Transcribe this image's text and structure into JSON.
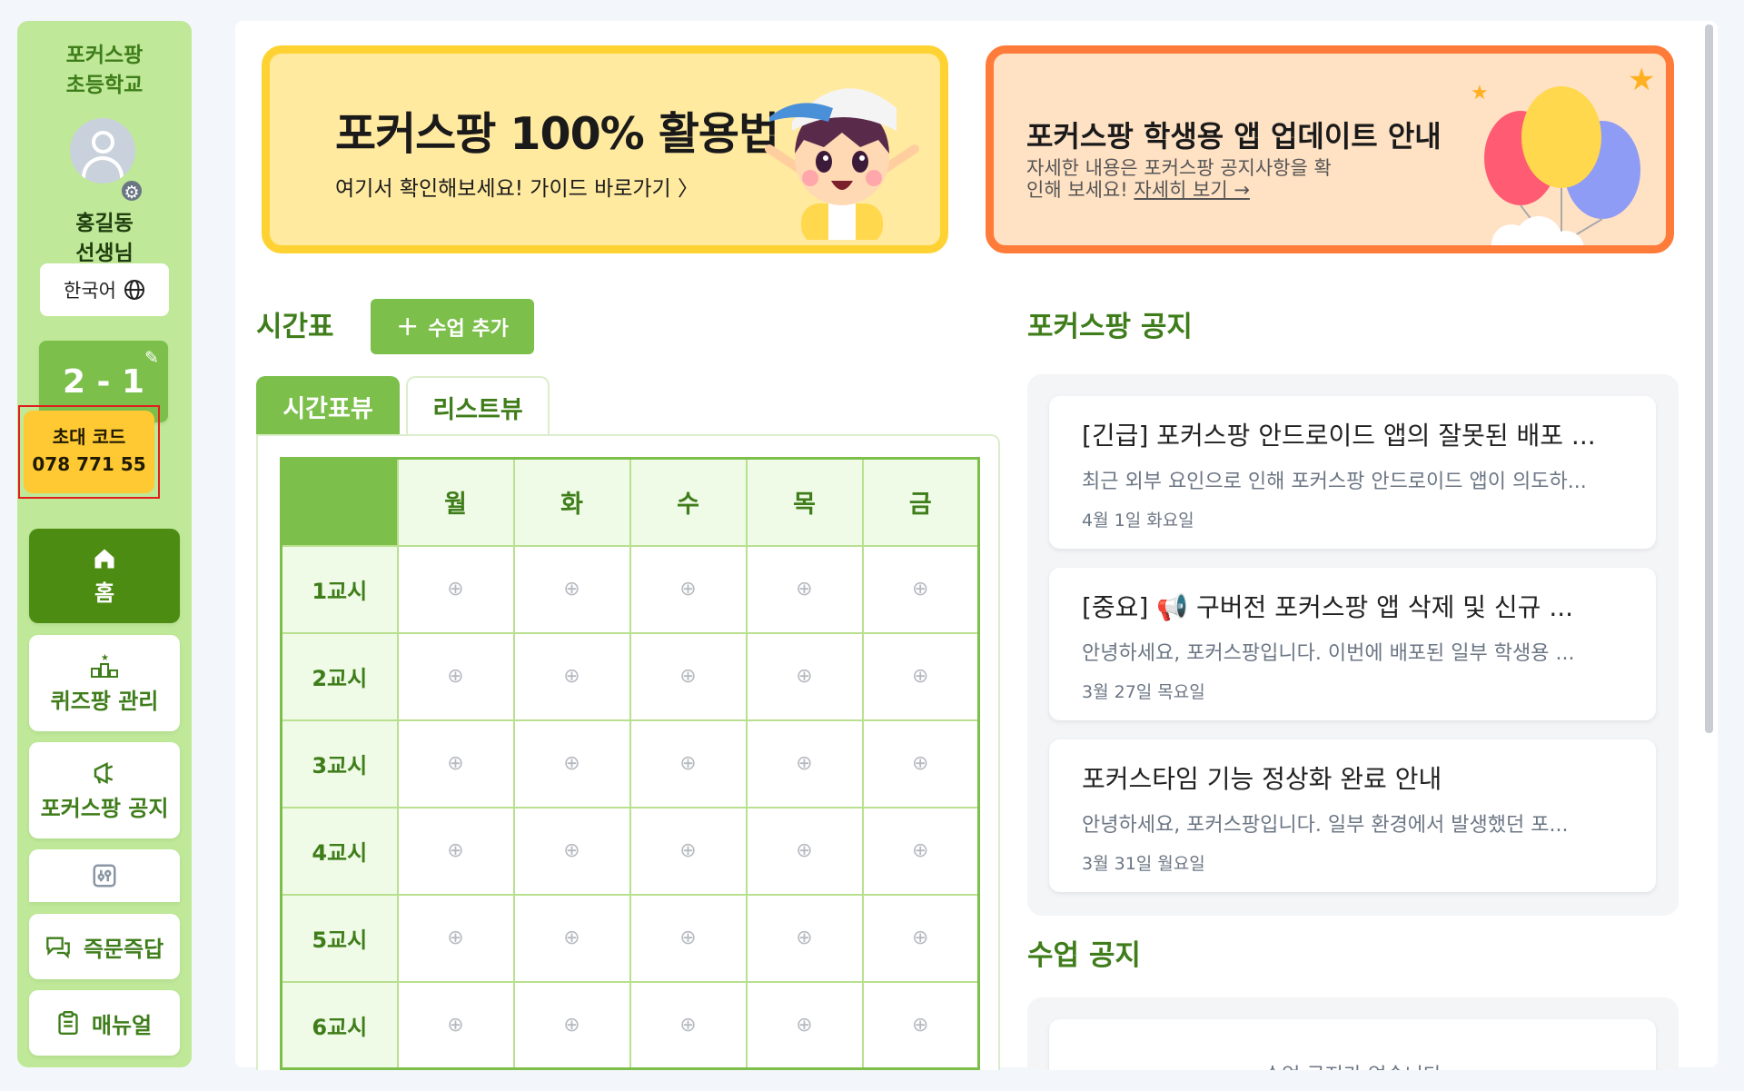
{
  "sidebar": {
    "school_name_line1": "포커스팡",
    "school_name_line2": "초등학교",
    "teacher_line1": "홍길동",
    "teacher_line2": "선생님",
    "language": "한국어",
    "class_name": "2 - 1",
    "invite_label": "초대 코드",
    "invite_code": "078 771 55",
    "nav": {
      "home": "홈",
      "quiz": "퀴즈팡 관리",
      "notice": "포커스팡 공지",
      "qna": "즉문즉답",
      "manual": "매뉴얼"
    }
  },
  "banners": {
    "guide_title": "포커스팡 100% 활용법",
    "guide_sub": "여기서 확인해보세요! 가이드 바로가기 〉",
    "update_title": "포커스팡 학생용 앱 업데이트 안내",
    "update_sub_line1": "자세한 내용은 포커스팡 공지사항을 확",
    "update_sub_line2": "인해 보세요!",
    "update_link": "자세히 보기 →"
  },
  "timetable": {
    "title": "시간표",
    "add_button": "수업 추가",
    "tabs": [
      "시간표뷰",
      "리스트뷰"
    ],
    "days": [
      "월",
      "화",
      "수",
      "목",
      "금"
    ],
    "periods": [
      "1교시",
      "2교시",
      "3교시",
      "4교시",
      "5교시",
      "6교시"
    ]
  },
  "notices": {
    "title": "포커스팡 공지",
    "items": [
      {
        "title": "[긴급] 포커스팡 안드로이드 앱의 잘못된 배포 ...",
        "body": "최근 외부 요인으로 인해 포커스팡 안드로이드 앱이 의도하...",
        "date": "4월 1일 화요일"
      },
      {
        "title": "[중요] 📢 구버전 포커스팡 앱 삭제 및 신규 ...",
        "body": "안녕하세요, 포커스팡입니다. 이번에 배포된 일부 학생용 ...",
        "date": "3월 27일 목요일"
      },
      {
        "title": "포커스타임 기능 정상화 완료 안내",
        "body": "안녕하세요, 포커스팡입니다. 일부 환경에서 발생했던 포...",
        "date": "3월 31일 월요일"
      }
    ]
  },
  "class_notice": {
    "title": "수업 공지",
    "empty": "수업 공지가 없습니다"
  },
  "colors": {
    "sidebar_bg": "#bfe898",
    "brand_green": "#7cbf4b",
    "dark_green": "#4d8c12",
    "invite_yellow": "#ffc933",
    "banner_yellow": "#ffd233",
    "banner_orange": "#ff7b3a"
  }
}
